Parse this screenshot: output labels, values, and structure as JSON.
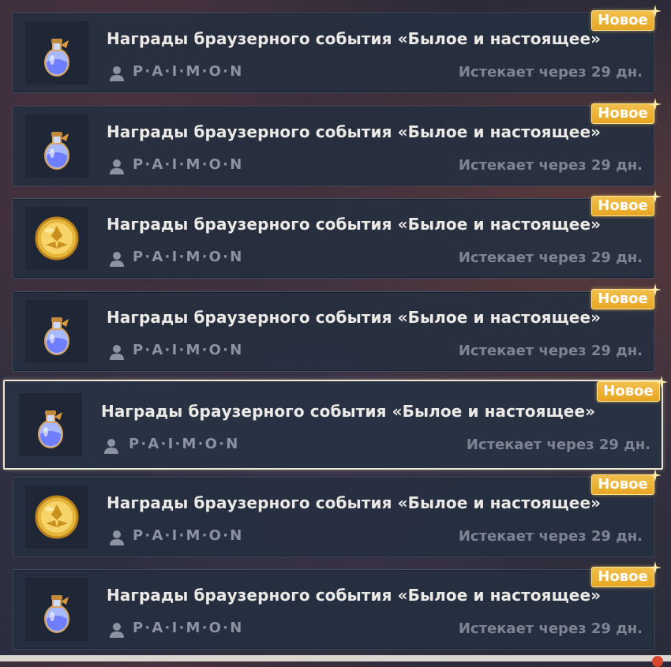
{
  "mail_list": {
    "items": [
      {
        "title": "Награды браузерного события «Былое и настоящее»",
        "sender": "P·A·I·M·O·N",
        "expires": "Истекает через 29 дн.",
        "badge": "Новое",
        "icon": "potion-bottle-icon",
        "selected": false
      },
      {
        "title": "Награды браузерного события «Былое и настоящее»",
        "sender": "P·A·I·M·O·N",
        "expires": "Истекает через 29 дн.",
        "badge": "Новое",
        "icon": "potion-bottle-icon",
        "selected": false
      },
      {
        "title": "Награды браузерного события «Былое и настоящее»",
        "sender": "P·A·I·M·O·N",
        "expires": "Истекает через 29 дн.",
        "badge": "Новое",
        "icon": "mora-coin-icon",
        "selected": false
      },
      {
        "title": "Награды браузерного события «Былое и настоящее»",
        "sender": "P·A·I·M·O·N",
        "expires": "Истекает через 29 дн.",
        "badge": "Новое",
        "icon": "potion-bottle-icon",
        "selected": false
      },
      {
        "title": "Награды браузерного события «Былое и настоящее»",
        "sender": "P·A·I·M·O·N",
        "expires": "Истекает через 29 дн.",
        "badge": "Новое",
        "icon": "potion-bottle-icon",
        "selected": true
      },
      {
        "title": "Награды браузерного события «Былое и настоящее»",
        "sender": "P·A·I·M·O·N",
        "expires": "Истекает через 29 дн.",
        "badge": "Новое",
        "icon": "mora-coin-icon",
        "selected": false
      },
      {
        "title": "Награды браузерного события «Былое и настоящее»",
        "sender": "P·A·I·M·O·N",
        "expires": "Истекает через 29 дн.",
        "badge": "Новое",
        "icon": "potion-bottle-icon",
        "selected": false
      }
    ]
  },
  "colors": {
    "badge_gold": "#f0b63c",
    "selected_border": "#ece5d1",
    "title_text": "#eceae6",
    "muted_text": "#8b93a3"
  }
}
